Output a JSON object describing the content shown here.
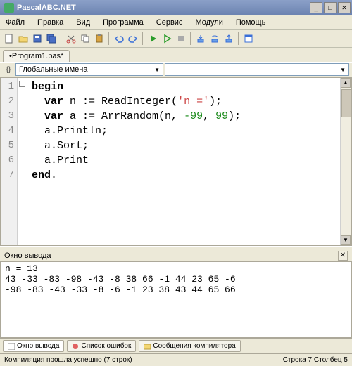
{
  "title": "PascalABC.NET",
  "menu": [
    "Файл",
    "Правка",
    "Вид",
    "Программа",
    "Сервис",
    "Модули",
    "Помощь"
  ],
  "tab": "•Program1.pas*",
  "nav_label": "Глобальные имена",
  "gutter": [
    "1",
    "2",
    "3",
    "4",
    "5",
    "6",
    "7"
  ],
  "code": {
    "l1_kw": "begin",
    "l2_kw": "var",
    "l2_a": " n := ReadInteger(",
    "l2_str": "'n ='",
    "l2_b": ");",
    "l3_kw": "var",
    "l3_a": " a := ArrRandom(n, ",
    "l3_n1": "-99",
    "l3_b": ", ",
    "l3_n2": "99",
    "l3_c": ");",
    "l4": "a.Println;",
    "l5": "a.Sort;",
    "l6": "a.Print",
    "l7_kw": "end",
    "l7_b": "."
  },
  "output_title": "Окно вывода",
  "output_lines": [
    "n = 13",
    "43 -33 -83 -98 -43 -8 38 66 -1 44 23 65 -6",
    "-98 -83 -43 -33 -8 -6 -1 23 38 43 44 65 66"
  ],
  "bottom_tabs": [
    "Окно вывода",
    "Список ошибок",
    "Сообщения компилятора"
  ],
  "status_left": "Компиляция прошла успешно (7 строк)",
  "status_right": "Строка  7 Столбец  5"
}
